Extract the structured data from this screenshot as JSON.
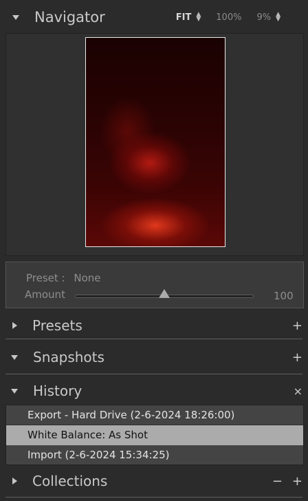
{
  "navigator": {
    "title": "Navigator",
    "zoom_options": [
      "FIT",
      "100%",
      "9%"
    ]
  },
  "preset_panel": {
    "preset_label": "Preset :",
    "preset_value": "None",
    "amount_label": "Amount",
    "amount_value": "100",
    "amount_level": 0.5
  },
  "presets": {
    "title": "Presets",
    "icon": "plus-icon"
  },
  "snapshots": {
    "title": "Snapshots",
    "icon": "plus-icon"
  },
  "history": {
    "title": "History",
    "icon": "close-icon",
    "items": [
      "Export - Hard Drive (2-6-2024 18:26:00)",
      "White Balance: As Shot",
      "Import (2-6-2024 15:34:25)"
    ]
  },
  "collections": {
    "title": "Collections",
    "icons": [
      "minus-icon",
      "plus-icon"
    ]
  },
  "colors": {
    "panel_bg": "#2b2b2b",
    "selected_row": "#ababab",
    "photo_tint": "#b21a12"
  }
}
